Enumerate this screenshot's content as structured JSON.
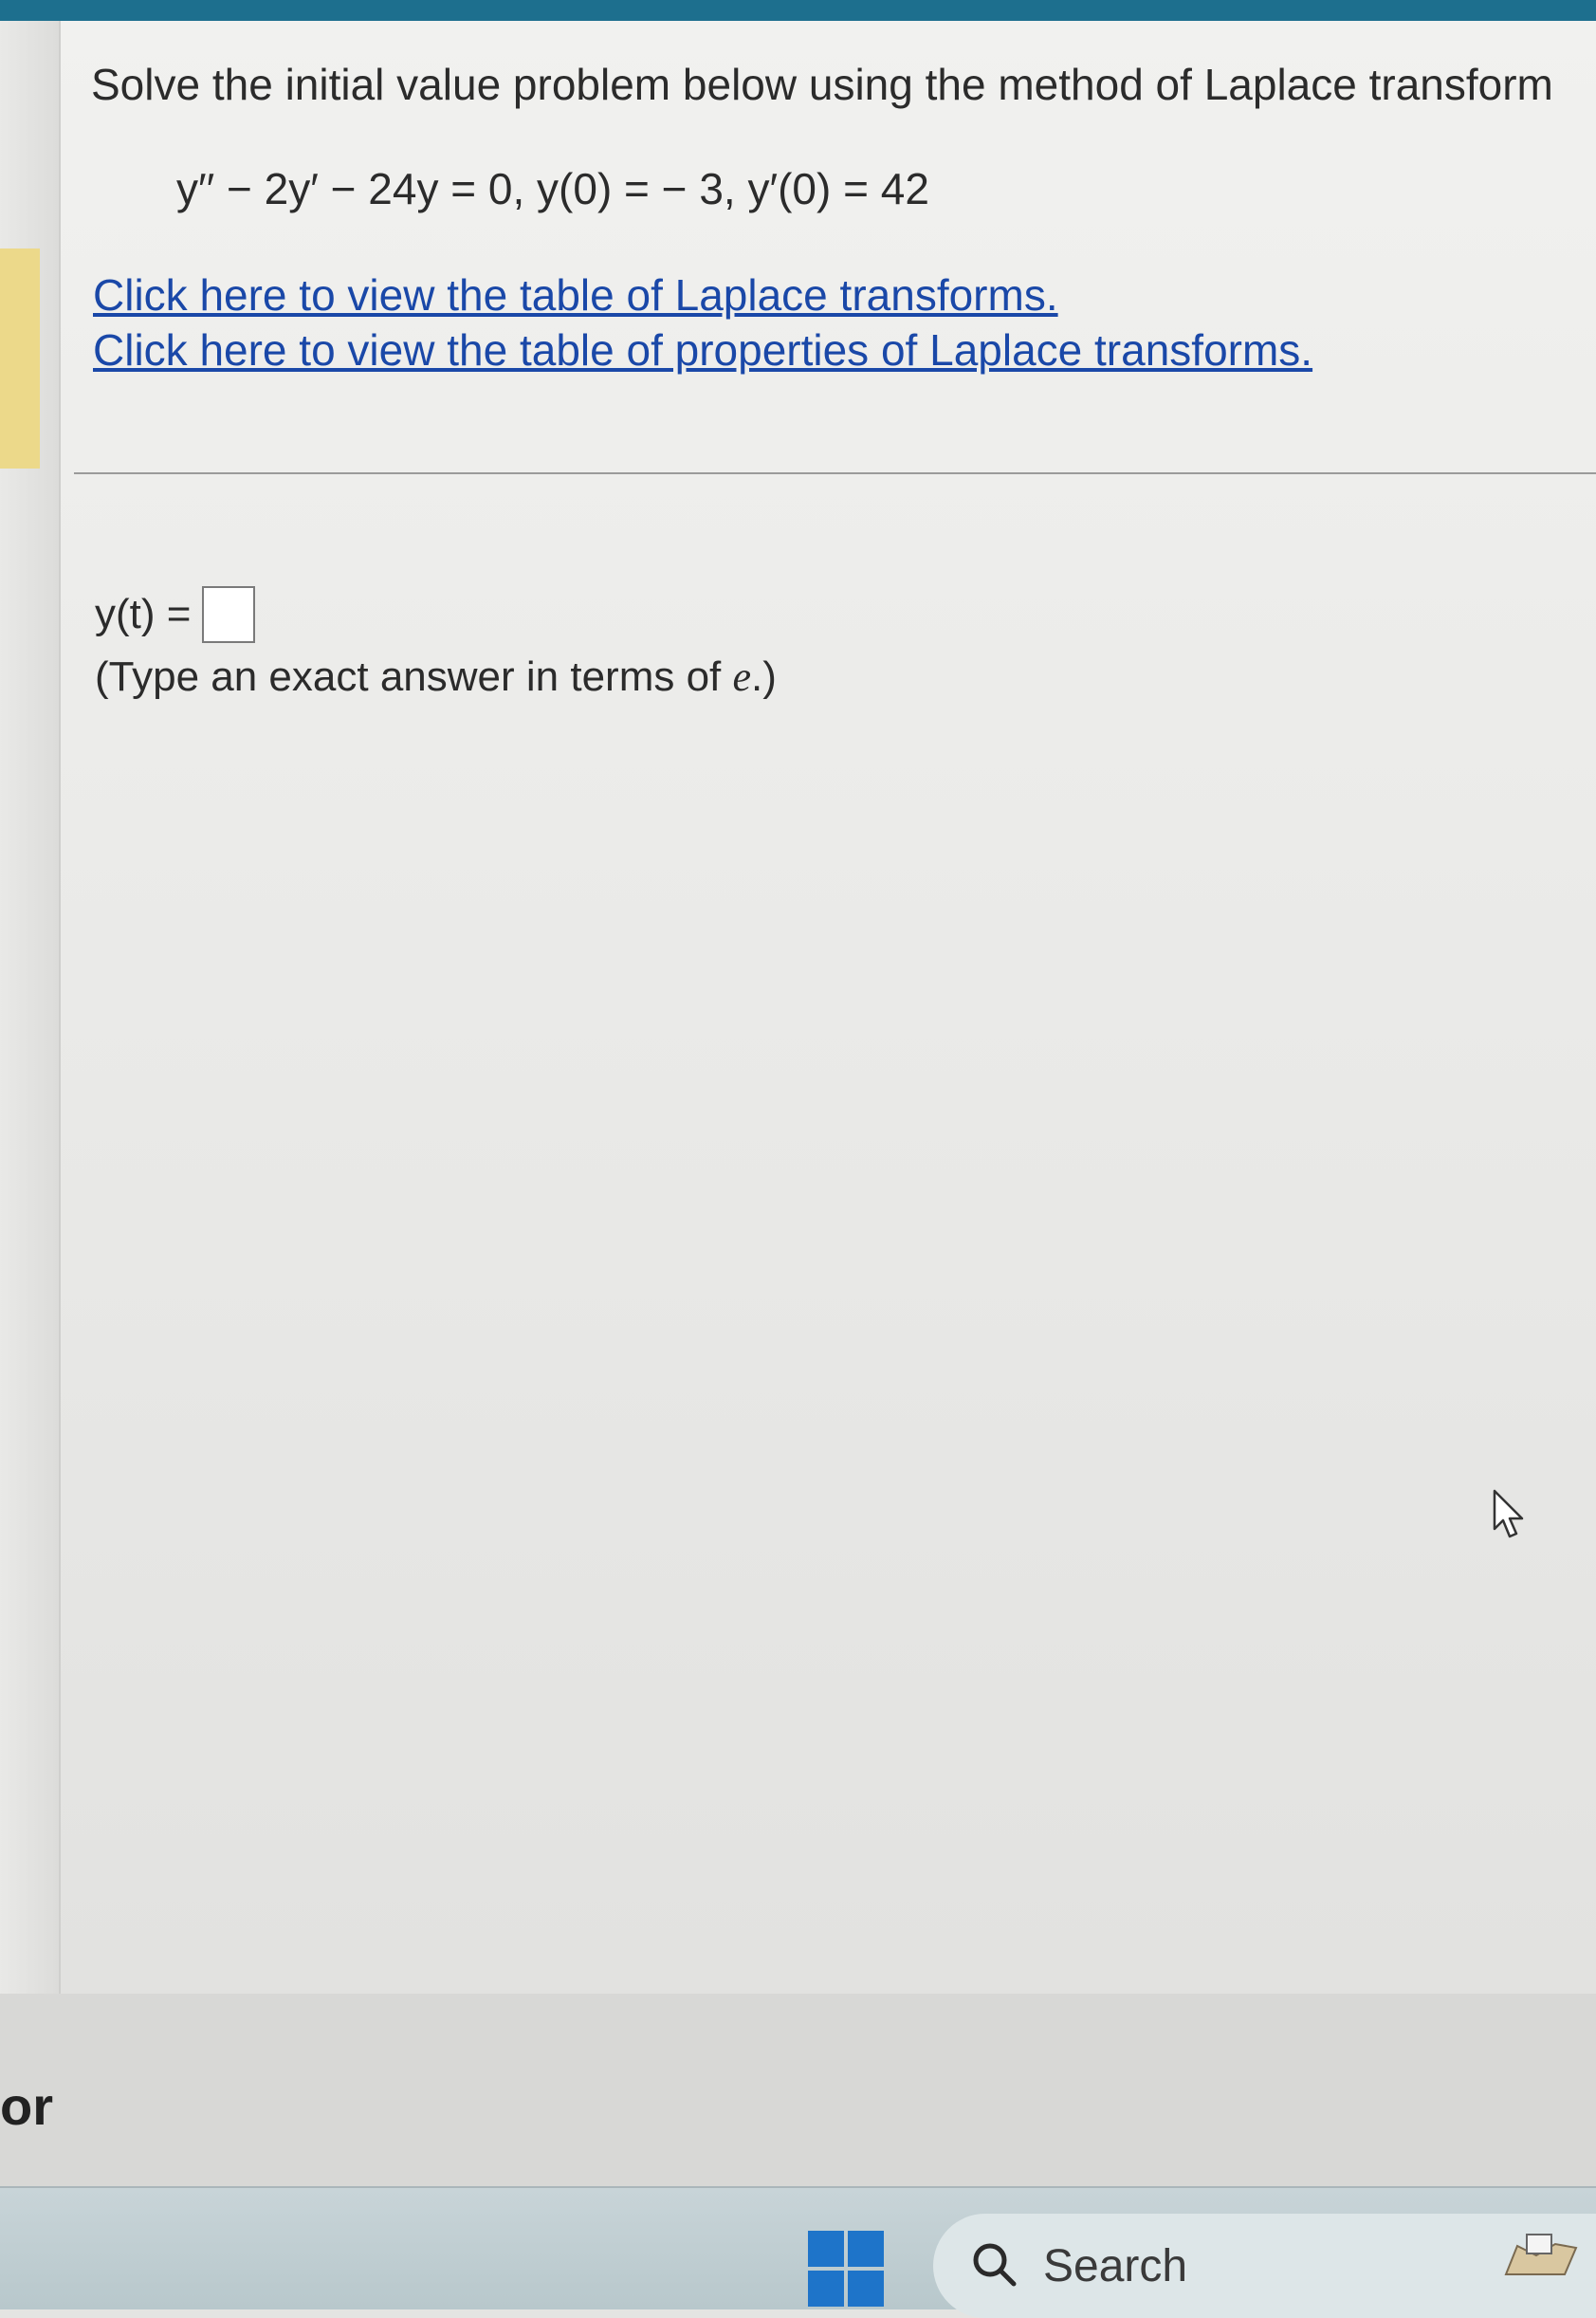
{
  "question": {
    "prompt": "Solve the initial value problem below using the method of Laplace transform",
    "equation": "y′′ − 2y′ − 24y = 0, y(0) = − 3, y′(0) = 42"
  },
  "links": {
    "table_transforms": "Click here to view the table of Laplace transforms.",
    "table_properties": "Click here to view the table of properties of Laplace transforms."
  },
  "answer": {
    "label": "y(t) =",
    "value": "",
    "hint_prefix": "(Type an exact answer in terms of ",
    "hint_symbol": "e",
    "hint_suffix": ".)"
  },
  "edge_text": "or",
  "taskbar": {
    "search_label": "Search"
  },
  "colors": {
    "top_bar": "#1d6f8e",
    "link": "#1a48a8",
    "accent_bar": "#ecd98a",
    "windows_logo": "#1e74c9"
  },
  "icons": [
    "windows-start-icon",
    "search-icon",
    "mouse-pointer-icon",
    "tray-app-icon"
  ]
}
